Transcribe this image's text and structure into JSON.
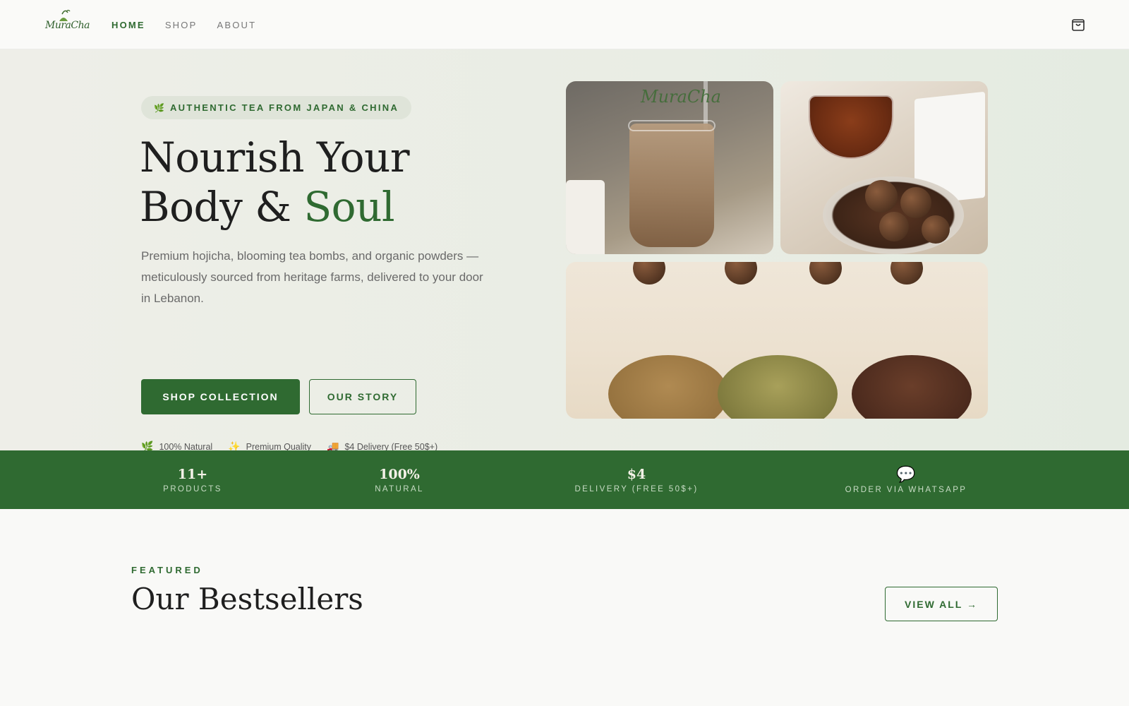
{
  "brand": {
    "logo_text": "MuraCha"
  },
  "nav": {
    "links": [
      {
        "label": "HOME",
        "active": true
      },
      {
        "label": "SHOP",
        "active": false
      },
      {
        "label": "ABOUT",
        "active": false
      }
    ],
    "cart_icon": "shopping-bag-icon"
  },
  "hero": {
    "badge_icon": "leaf-icon",
    "badge": "AUTHENTIC TEA FROM JAPAN & CHINA",
    "title_line1": "Nourish Your",
    "title_line2_prefix": "Body & ",
    "title_line2_accent": "Soul",
    "description": "Premium hojicha, blooming tea bombs, and organic powders — meticulously sourced from heritage farms, delivered to your door in Lebanon.",
    "primary_button": "SHOP COLLECTION",
    "secondary_button": "OUR STORY",
    "features": [
      {
        "icon": "🌿",
        "label": "100% Natural"
      },
      {
        "icon": "✨",
        "label": "Premium Quality"
      },
      {
        "icon": "🚚",
        "label": "$4 Delivery (Free 50$+)"
      }
    ],
    "image_overlay_logo": "MuraCha"
  },
  "stats": [
    {
      "value": "11+",
      "label": "PRODUCTS"
    },
    {
      "value": "100%",
      "label": "NATURAL"
    },
    {
      "value": "$4",
      "label": "DELIVERY (FREE 50$+)"
    },
    {
      "icon": "💬",
      "label": "ORDER VIA WHATSAPP"
    }
  ],
  "bestsellers": {
    "eyebrow": "FEATURED",
    "title": "Our Bestsellers",
    "view_all": "VIEW ALL →"
  },
  "colors": {
    "accent": "#2f6a31",
    "background": "#f9f9f7",
    "hero_background": "#eceee7",
    "stats_background": "#2f6a31"
  }
}
